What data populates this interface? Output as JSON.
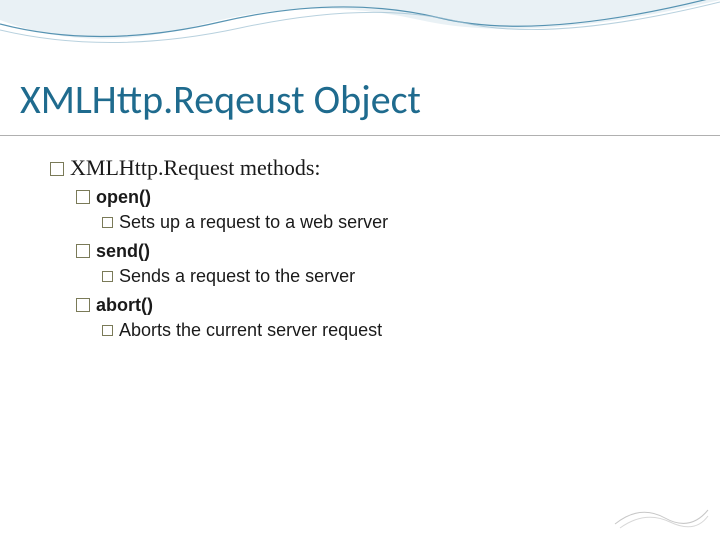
{
  "title": "XMLHttp.Reqeust Object",
  "intro": "XMLHttp.Request methods:",
  "methods": [
    {
      "name": "open()",
      "desc": "Sets up a request to a web server"
    },
    {
      "name": "send()",
      "desc": "Sends a request to the server"
    },
    {
      "name": "abort()",
      "desc": "Aborts the current server request"
    }
  ]
}
